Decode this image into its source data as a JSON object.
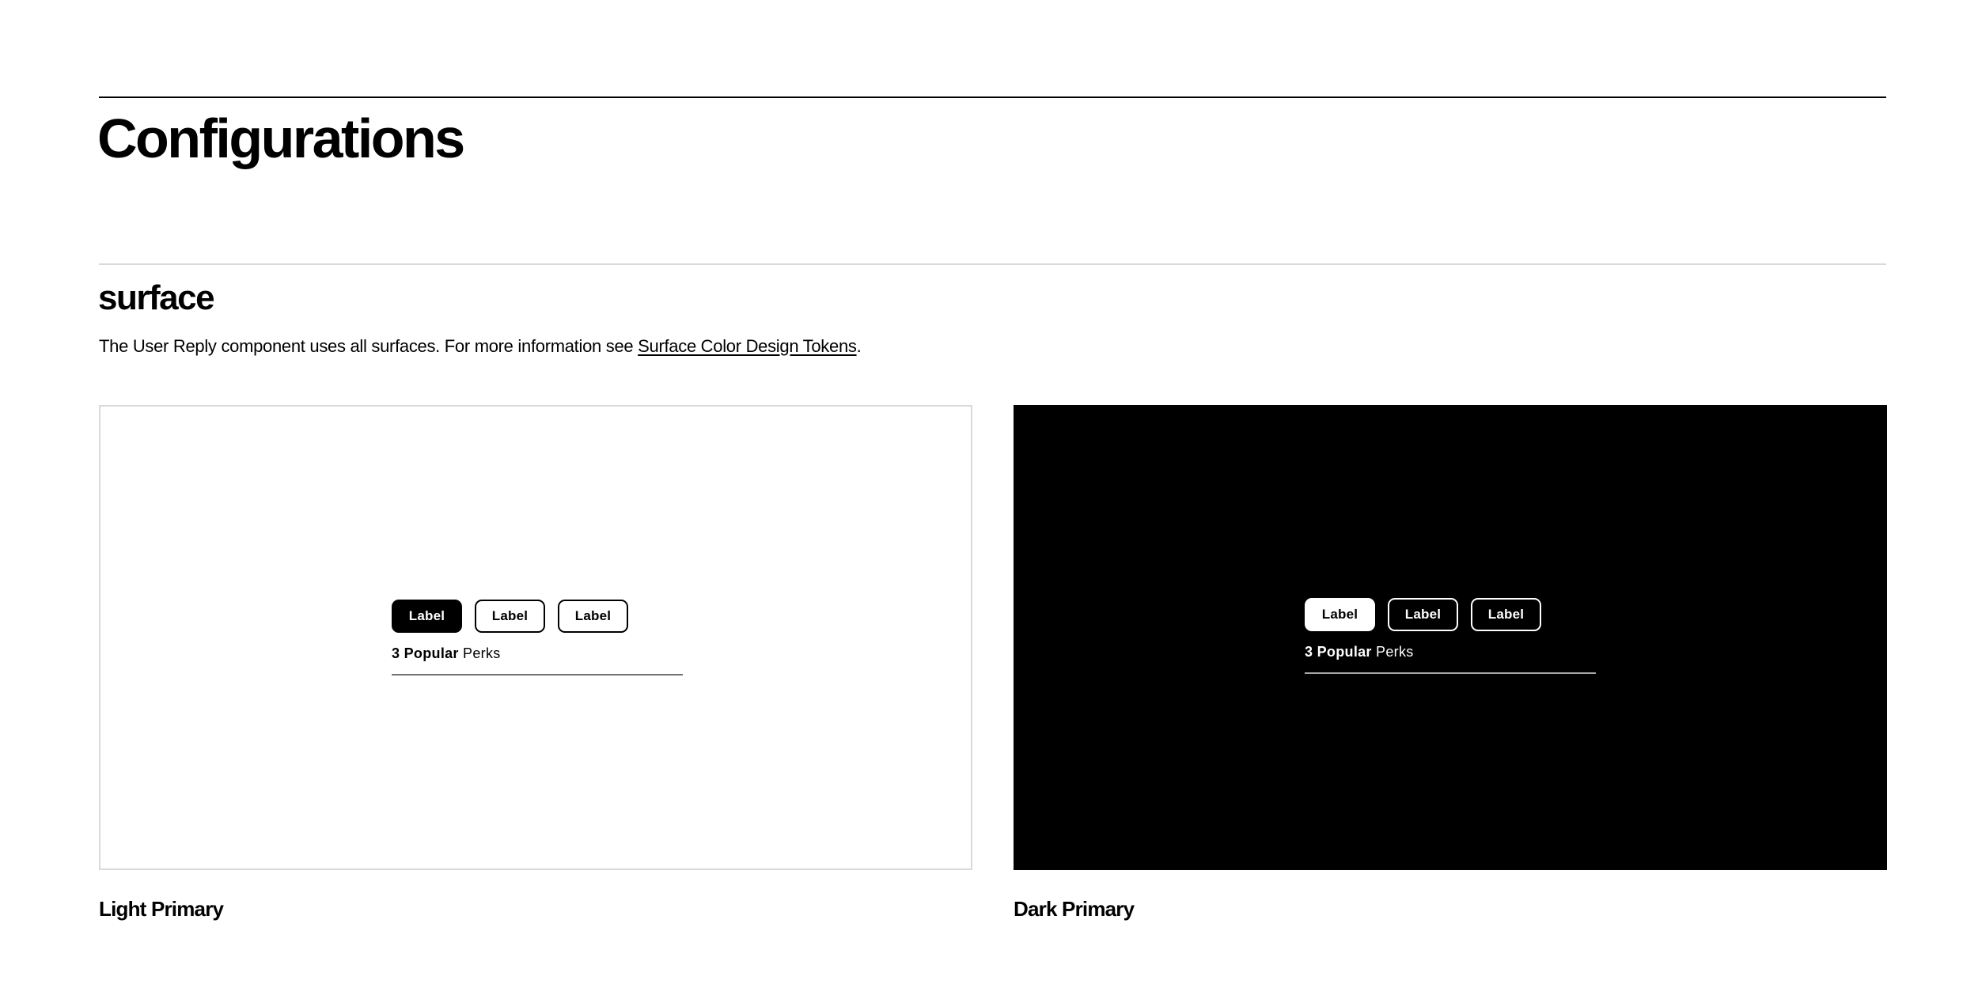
{
  "page": {
    "title": "Configurations"
  },
  "section": {
    "title": "surface",
    "description_prefix": "The User Reply component uses all surfaces. For more information see ",
    "description_link": "Surface Color Design Tokens",
    "description_suffix": "."
  },
  "examples": {
    "light": {
      "caption": "Light Primary",
      "chips": [
        "Label",
        "Label",
        "Label"
      ],
      "perks_count": "3",
      "perks_bold": "Popular",
      "perks_text": "Perks"
    },
    "dark": {
      "caption": "Dark Primary",
      "chips": [
        "Label",
        "Label",
        "Label"
      ],
      "perks_count": "3",
      "perks_bold": "Popular",
      "perks_text": "Perks"
    }
  },
  "colors": {
    "primary": "#000000",
    "background": "#ffffff",
    "divider": "#d8dada"
  }
}
